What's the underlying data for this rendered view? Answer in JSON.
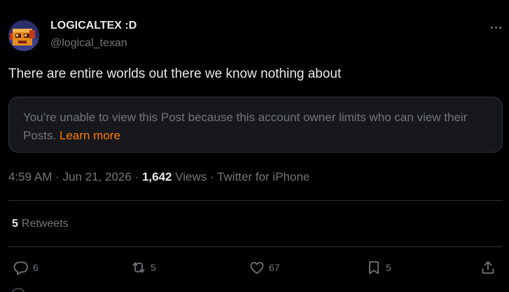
{
  "author": {
    "display_name": "LOGICALTEX :D",
    "handle": "@logical_texan",
    "avatar_icon": "pixel-robot-avatar"
  },
  "tweet": {
    "text": "There are entire worlds out there we know nothing about",
    "notice": {
      "text": "You’re unable to view this Post because this account owner limits who can view their Posts.",
      "link": "Learn more"
    },
    "meta": {
      "time": "4:59 AM",
      "date": "Jun 21, 2026",
      "views_count": "1,642",
      "views_label": "Views",
      "source": "Twitter for iPhone"
    },
    "retweets": {
      "count": "5",
      "label": "Retweets"
    },
    "actions": {
      "replies": "6",
      "retweets": "5",
      "likes": "67",
      "bookmarks": "5"
    }
  },
  "icons": {
    "more": "more-dots-icon",
    "reply": "reply-bubble-icon",
    "retweet": "retweet-arrows-icon",
    "like": "heart-icon",
    "bookmark": "bookmark-icon",
    "share": "share-upload-icon"
  },
  "colors": {
    "background": "#000000",
    "text_primary": "#e7e9ea",
    "text_secondary": "#71767b",
    "divider": "#2f3336",
    "notice_bg": "#16181c",
    "link": "#ff7a00"
  }
}
